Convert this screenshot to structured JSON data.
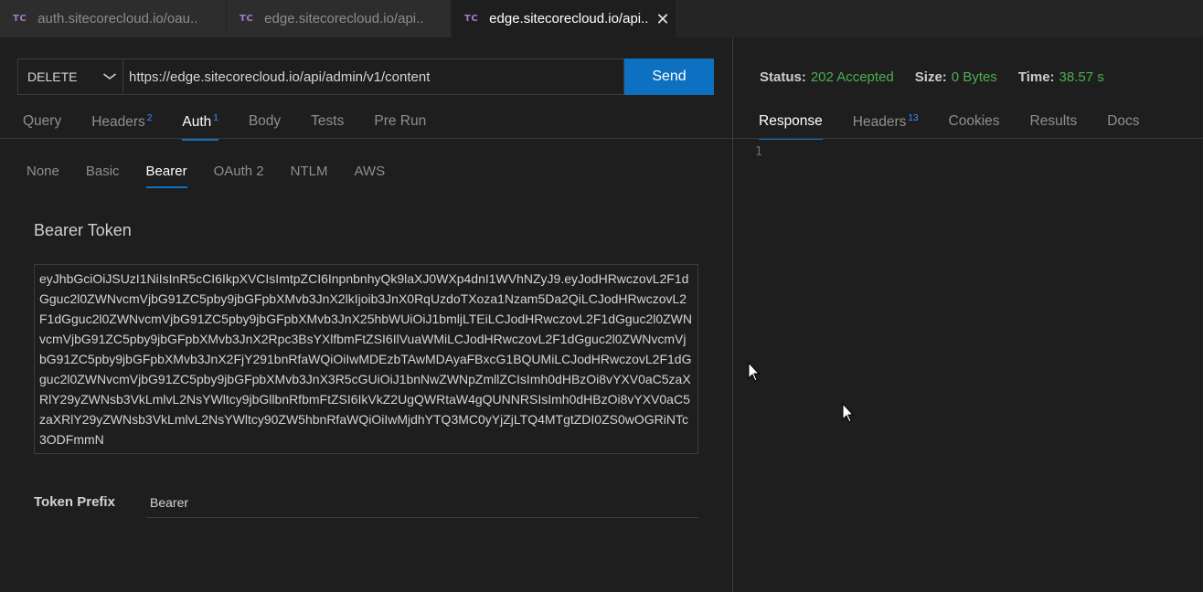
{
  "tabs": [
    {
      "icon": "TC",
      "label": "auth.sitecorecloud.io/oau..",
      "active": false
    },
    {
      "icon": "TC",
      "label": "edge.sitecorecloud.io/api..",
      "active": false
    },
    {
      "icon": "TC",
      "label": "edge.sitecorecloud.io/api..",
      "active": true,
      "close": "✕"
    }
  ],
  "request": {
    "method": "DELETE",
    "url": "https://edge.sitecorecloud.io/api/admin/v1/content",
    "send_label": "Send"
  },
  "request_tabs": [
    {
      "label": "Query",
      "badge": ""
    },
    {
      "label": "Headers",
      "badge": "2"
    },
    {
      "label": "Auth",
      "badge": "1"
    },
    {
      "label": "Body",
      "badge": ""
    },
    {
      "label": "Tests",
      "badge": ""
    },
    {
      "label": "Pre Run",
      "badge": ""
    }
  ],
  "auth_tabs": [
    "None",
    "Basic",
    "Bearer",
    "OAuth 2",
    "NTLM",
    "AWS"
  ],
  "auth": {
    "bearer_label": "Bearer Token",
    "token": "eyJhbGciOiJSUzI1NiIsInR5cCI6IkpXVCIsImtpZCI6InpnbnhyQk9laXJ0WXp4dnI1WVhNZyJ9.eyJodHRwczovL2F1dGguc2l0ZWNvcmVjbG91ZC5pby9jbGFpbXMvb3JnX2lkIjoib3JnX0RqUzdoTXoza1Nzam5Da2QiLCJodHRwczovL2F1dGguc2l0ZWNvcmVjbG91ZC5pby9jbGFpbXMvb3JnX25hbWUiOiJ1bmljLTEiLCJodHRwczovL2F1dGguc2l0ZWNvcmVjbG91ZC5pby9jbGFpbXMvb3JnX2Rpc3BsYXlfbmFtZSI6IlVuaWMiLCJodHRwczovL2F1dGguc2l0ZWNvcmVjbG91ZC5pby9jbGFpbXMvb3JnX2FjY291bnRfaWQiOiIwMDEzbTAwMDAyaFBxcG1BQUMiLCJodHRwczovL2F1dGguc2l0ZWNvcmVjbG91ZC5pby9jbGFpbXMvb3JnX3R5cGUiOiJ1bnNwZWNpZmllZCIsImh0dHBzOi8vYXV0aC5zaXRlY29yZWNsb3VkLmlvL2NsYWltcy9jbGllbnRfbmFtZSI6IkVkZ2UgQWRtaW4gQUNNRSIsImh0dHBzOi8vYXV0aC5zaXRlY29yZWNsb3VkLmlvL2NsYWltcy90ZW5hbnRfaWQiOiIwMjdhYTQ3MC0yYjZjLTQ4MTgtZDI0ZS0wOGRiNTc3ODFmmN",
    "prefix_label": "Token Prefix",
    "prefix_value": "Bearer"
  },
  "response_status": {
    "status_label": "Status:",
    "status_value": "202 Accepted",
    "size_label": "Size:",
    "size_value": "0 Bytes",
    "time_label": "Time:",
    "time_value": "38.57 s"
  },
  "response_tabs": [
    {
      "label": "Response",
      "badge": ""
    },
    {
      "label": "Headers",
      "badge": "13"
    },
    {
      "label": "Cookies",
      "badge": ""
    },
    {
      "label": "Results",
      "badge": ""
    },
    {
      "label": "Docs",
      "badge": ""
    }
  ],
  "response_body": {
    "line_number": "1"
  },
  "colors": {
    "accent": "#0e70c0",
    "status_ok": "#4caf50",
    "badge": "#3794ff",
    "icon_tc": "#a37acc"
  }
}
